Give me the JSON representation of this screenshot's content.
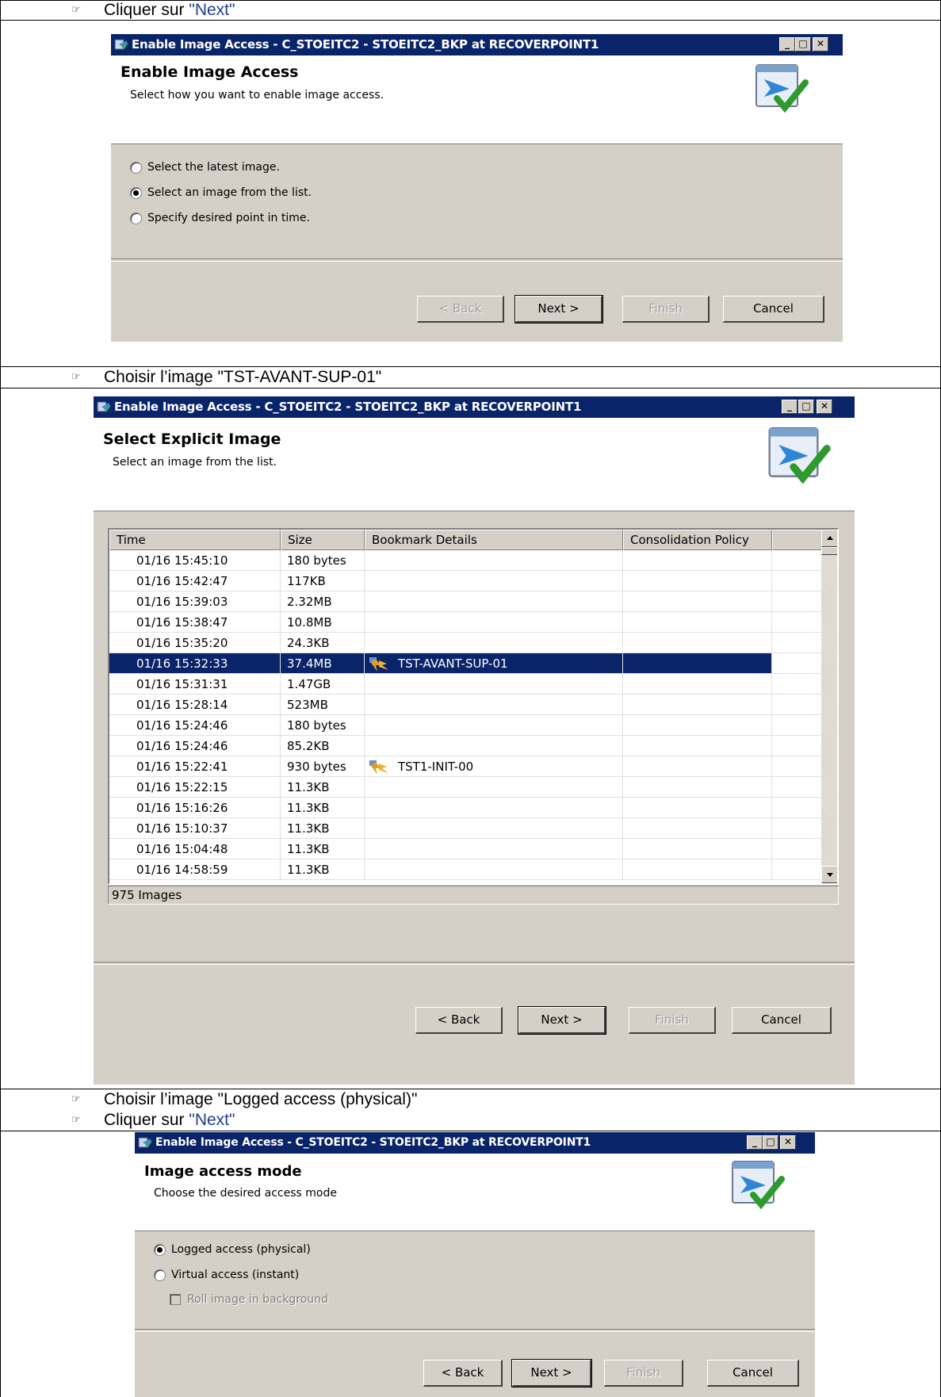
{
  "doc": {
    "step1": {
      "text": "Cliquer sur ",
      "link": "\"Next\""
    },
    "step2": {
      "text": "Choisir l’image \"TST-AVANT-SUP-01\""
    },
    "step3": {
      "text": "Choisir l’image \"Logged access (physical)\""
    },
    "step4": {
      "text": "Cliquer sur ",
      "link": "\"Next\""
    },
    "bullet_glyph": "☞"
  },
  "window_title": "Enable Image Access - C_STOEITC2 - STOEITC2_BKP at RECOVERPOINT1",
  "titlebar_buttons": {
    "minimize": "_",
    "maximize": "□",
    "close": "✕"
  },
  "dialog1": {
    "heading": "Enable Image Access",
    "subheading": "Select how you want to enable image access.",
    "options": [
      {
        "label": "Select the latest image.",
        "checked": false
      },
      {
        "label": "Select an image from the list.",
        "checked": true
      },
      {
        "label": "Specify desired point in time.",
        "checked": false
      }
    ],
    "buttons": {
      "back": "< Back",
      "next": "Next >",
      "finish": "Finish",
      "cancel": "Cancel"
    }
  },
  "dialog2": {
    "heading": "Select Explicit Image",
    "subheading": "Select an image from the list.",
    "columns": [
      "Time",
      "Size",
      "Bookmark Details",
      "Consolidation Policy"
    ],
    "rows": [
      {
        "time": "01/16 15:45:10",
        "size": "180 bytes",
        "bookmark": "",
        "policy": ""
      },
      {
        "time": "01/16 15:42:47",
        "size": "117KB",
        "bookmark": "",
        "policy": ""
      },
      {
        "time": "01/16 15:39:03",
        "size": "2.32MB",
        "bookmark": "",
        "policy": ""
      },
      {
        "time": "01/16 15:38:47",
        "size": "10.8MB",
        "bookmark": "",
        "policy": ""
      },
      {
        "time": "01/16 15:35:20",
        "size": "24.3KB",
        "bookmark": "",
        "policy": ""
      },
      {
        "time": "01/16 15:32:33",
        "size": "37.4MB",
        "bookmark": "TST-AVANT-SUP-01",
        "policy": "",
        "selected": true
      },
      {
        "time": "01/16 15:31:31",
        "size": "1.47GB",
        "bookmark": "",
        "policy": ""
      },
      {
        "time": "01/16 15:28:14",
        "size": "523MB",
        "bookmark": "",
        "policy": ""
      },
      {
        "time": "01/16 15:24:46",
        "size": "180 bytes",
        "bookmark": "",
        "policy": ""
      },
      {
        "time": "01/16 15:24:46",
        "size": "85.2KB",
        "bookmark": "",
        "policy": ""
      },
      {
        "time": "01/16 15:22:41",
        "size": "930 bytes",
        "bookmark": "TST1-INIT-00",
        "policy": ""
      },
      {
        "time": "01/16 15:22:15",
        "size": "11.3KB",
        "bookmark": "",
        "policy": ""
      },
      {
        "time": "01/16 15:16:26",
        "size": "11.3KB",
        "bookmark": "",
        "policy": ""
      },
      {
        "time": "01/16 15:10:37",
        "size": "11.3KB",
        "bookmark": "",
        "policy": ""
      },
      {
        "time": "01/16 15:04:48",
        "size": "11.3KB",
        "bookmark": "",
        "policy": ""
      },
      {
        "time": "01/16 14:58:59",
        "size": "11.3KB",
        "bookmark": "",
        "policy": ""
      }
    ],
    "status": "975 Images",
    "buttons": {
      "back": "< Back",
      "next": "Next >",
      "finish": "Finish",
      "cancel": "Cancel"
    }
  },
  "dialog3": {
    "heading": "Image access mode",
    "subheading": "Choose the desired access mode",
    "options": [
      {
        "label": "Logged access (physical)",
        "checked": true
      },
      {
        "label": "Virtual access (instant)",
        "checked": false
      }
    ],
    "checkbox": {
      "label": "Roll image in background",
      "checked": false,
      "enabled": false
    },
    "buttons": {
      "back": "< Back",
      "next": "Next >",
      "finish": "Finish",
      "cancel": "Cancel"
    }
  },
  "colors": {
    "titlebar": "#0a246a",
    "dialog_bg": "#d4d0c8",
    "link": "#1f3f8f",
    "selection": "#0a246a"
  },
  "icons": [
    "window-app-icon",
    "wizard-check-icon",
    "bookmark-icon",
    "radio-icon",
    "checkbox-icon",
    "scroll-up-icon",
    "scroll-down-icon",
    "bullet-pointer-icon"
  ]
}
